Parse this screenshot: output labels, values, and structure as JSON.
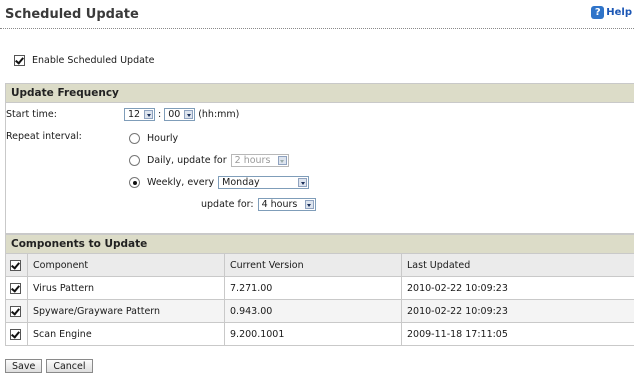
{
  "header": {
    "title": "Scheduled Update",
    "help_label": "Help"
  },
  "enable": {
    "label": "Enable Scheduled Update",
    "checked": true
  },
  "frequency": {
    "heading": "Update Frequency",
    "start_time_label": "Start time:",
    "hour": "12",
    "minute": "00",
    "time_sep": ":",
    "time_format": "(hh:mm)",
    "repeat_label": "Repeat interval:",
    "hourly_label": "Hourly",
    "daily_label": "Daily, update for",
    "daily_duration": "2 hours",
    "weekly_label": "Weekly, every",
    "weekly_day": "Monday",
    "weekly_update_for_label": "update for:",
    "weekly_duration": "4 hours",
    "selected_interval": "weekly"
  },
  "components": {
    "heading": "Components to Update",
    "columns": [
      "Component",
      "Current Version",
      "Last Updated"
    ],
    "rows": [
      {
        "name": "Virus Pattern",
        "version": "7.271.00",
        "updated": "2010-02-22 10:09:23"
      },
      {
        "name": "Spyware/Grayware Pattern",
        "version": "0.943.00",
        "updated": "2010-02-22 10:09:23"
      },
      {
        "name": "Scan Engine",
        "version": "9.200.1001",
        "updated": "2009-11-18 17:11:05"
      }
    ]
  },
  "buttons": {
    "save": "Save",
    "cancel": "Cancel"
  }
}
